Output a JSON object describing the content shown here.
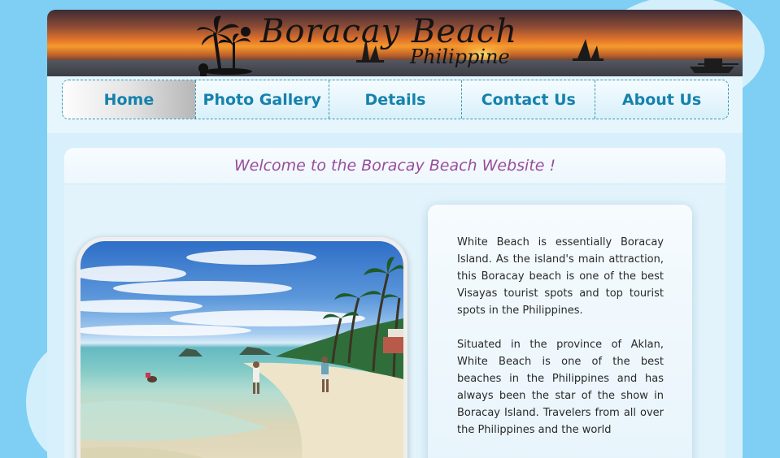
{
  "banner": {
    "title": "Boracay Beach",
    "subtitle": "Philippine"
  },
  "nav": {
    "items": [
      {
        "label": "Home",
        "active": true
      },
      {
        "label": "Photo Gallery",
        "active": false
      },
      {
        "label": "Details",
        "active": false
      },
      {
        "label": "Contact Us",
        "active": false
      },
      {
        "label": "About Us",
        "active": false
      }
    ]
  },
  "main": {
    "welcome": "Welcome to the Boracay Beach Website !",
    "paragraphs": [
      "White Beach is essentially Boracay Island. As the island's main attraction, this Boracay beach is one of the best Visayas tourist spots and top tourist spots in the Philippines.",
      "Situated in the province of Aklan, White Beach is one of the best beaches in the Philippines and has always been the star of the show in Boracay Island. Travelers from all over the Philippines and the world"
    ]
  },
  "colors": {
    "background": "#7ecff3",
    "nav_text": "#1582ad",
    "welcome_text": "#9a4c9a"
  }
}
